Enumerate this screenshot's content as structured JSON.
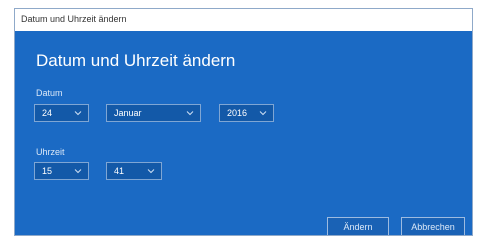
{
  "window": {
    "title": "Datum und Uhrzeit ändern"
  },
  "dialog": {
    "heading": "Datum und Uhrzeit ändern",
    "date": {
      "label": "Datum",
      "day": "24",
      "month": "Januar",
      "year": "2016"
    },
    "time": {
      "label": "Uhrzeit",
      "hour": "15",
      "minute": "41"
    },
    "buttons": {
      "change": "Ändern",
      "cancel": "Abbrechen"
    }
  },
  "colors": {
    "background": "#1b6ac4",
    "field": "#1359a8",
    "border": "#7fa6d4",
    "text": "#ffffff"
  },
  "icons": {
    "dropdown": "chevron-down-icon"
  }
}
